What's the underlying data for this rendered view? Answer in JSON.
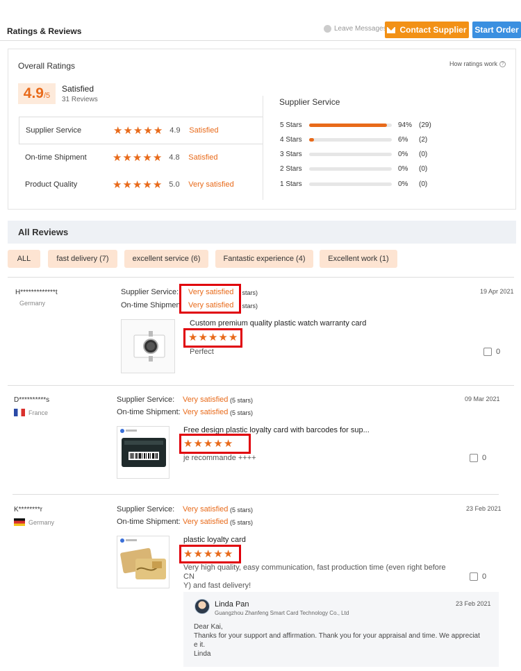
{
  "header": {
    "title": "Ratings & Reviews",
    "leave_messages": "Leave Messages",
    "contact_supplier": "Contact Supplier",
    "start_order": "Start Order"
  },
  "overall": {
    "title": "Overall Ratings",
    "how_ratings": "How ratings work",
    "score": "4.9",
    "out_of": "/5",
    "word": "Satisfied",
    "reviews": "31 Reviews",
    "metrics": [
      {
        "label": "Supplier Service",
        "stars": 5,
        "score": "4.9",
        "word": "Satisfied"
      },
      {
        "label": "On-time Shipment",
        "stars": 5,
        "score": "4.8",
        "word": "Satisfied"
      },
      {
        "label": "Product Quality",
        "stars": 5,
        "score": "5.0",
        "word": "Very satisfied"
      }
    ]
  },
  "supplier_service": {
    "title": "Supplier Service",
    "rows": [
      {
        "label": "5 Stars",
        "fraction": 0.94,
        "pct": "94%",
        "count": "(29)"
      },
      {
        "label": "4 Stars",
        "fraction": 0.06,
        "pct": "6%",
        "count": "(2)"
      },
      {
        "label": "3 Stars",
        "fraction": 0,
        "pct": "0%",
        "count": "(0)"
      },
      {
        "label": "2 Stars",
        "fraction": 0,
        "pct": "0%",
        "count": "(0)"
      },
      {
        "label": "1 Stars",
        "fraction": 0,
        "pct": "0%",
        "count": "(0)"
      }
    ]
  },
  "all_reviews": {
    "title": "All Reviews",
    "tags": [
      "ALL",
      "fast delivery (7)",
      "excellent service (6)",
      "Fantastic experience (4)",
      "Excellent work (1)"
    ]
  },
  "labels": {
    "supplier_service": "Supplier Service:",
    "ontime_shipment": "On-time Shipment:"
  },
  "reviews": [
    {
      "name": "H*************t",
      "country": "Germany",
      "supplier_service": "Very satisfied",
      "supplier_stars": "(5 stars)",
      "ontime": "Very satisfied",
      "ontime_stars": "(5 stars)",
      "date": "19 Apr 2021",
      "product": "Custom premium quality plastic watch warranty card",
      "stars": 5,
      "text": "Perfect",
      "likes": "0"
    },
    {
      "name": "D**********s",
      "country": "France",
      "supplier_service": "Very satisfied",
      "supplier_stars": "(5 stars)",
      "ontime": "Very satisfied",
      "ontime_stars": "(5 stars)",
      "date": "09 Mar 2021",
      "product": "Free design plastic loyalty card with barcodes for sup...",
      "stars": 5,
      "text": "je recommande ++++",
      "likes": "0"
    },
    {
      "name": "K********r",
      "country": "Germany",
      "supplier_service": "Very satisfied",
      "supplier_stars": "(5 stars)",
      "ontime": "Very satisfied",
      "ontime_stars": "(5 stars)",
      "date": "23 Feb 2021",
      "product": "plastic loyalty card",
      "stars": 5,
      "text_line1": "Very high quality, easy communication, fast production time (even right before CN",
      "text_line2": "Y) and fast delivery!",
      "likes": "0"
    }
  ],
  "reply": {
    "name": "Linda Pan",
    "company": "Guangzhou Zhanfeng Smart Card Technology Co., Ltd",
    "date": "23 Feb 2021",
    "line1": "Dear Kai,",
    "line2": "Thanks for your support and affirmation. Thank you for your appraisal and time. We appreciat",
    "line3": "e it.",
    "line4": "Linda"
  },
  "colors": {
    "accent": "#e86a1a",
    "contact_button": "#f29116",
    "order_button": "#3a8fe0",
    "highlight_box": "#e0000a"
  }
}
